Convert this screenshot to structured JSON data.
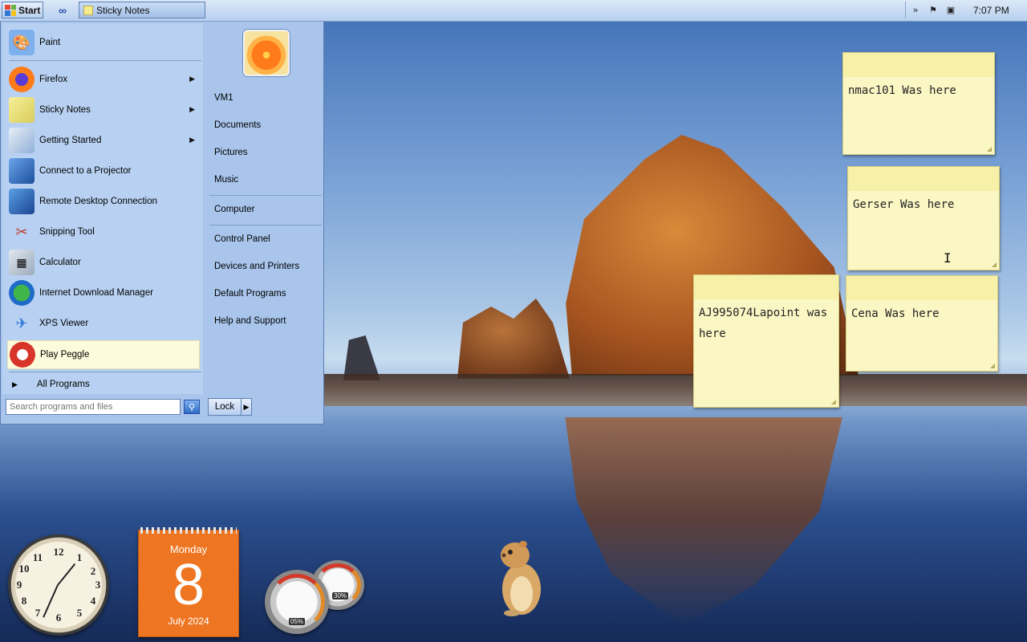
{
  "taskbar": {
    "start_label": "Start",
    "task_items": [
      {
        "label": "Sticky Notes"
      }
    ],
    "clock": "7:07 PM"
  },
  "start_menu": {
    "programs": [
      {
        "label": "Paint",
        "icon": "paint-icon",
        "has_submenu": false
      },
      {
        "label": "Firefox",
        "icon": "firefox-icon",
        "has_submenu": true
      },
      {
        "label": "Sticky Notes",
        "icon": "sticky-notes-icon",
        "has_submenu": true
      },
      {
        "label": "Getting Started",
        "icon": "getting-started-icon",
        "has_submenu": true
      },
      {
        "label": "Connect to a Projector",
        "icon": "projector-icon",
        "has_submenu": false
      },
      {
        "label": "Remote Desktop Connection",
        "icon": "remote-desktop-icon",
        "has_submenu": false
      },
      {
        "label": "Snipping Tool",
        "icon": "scissors-icon",
        "has_submenu": false
      },
      {
        "label": "Calculator",
        "icon": "calculator-icon",
        "has_submenu": false
      },
      {
        "label": "Internet Download Manager",
        "icon": "download-manager-icon",
        "has_submenu": false
      },
      {
        "label": "XPS Viewer",
        "icon": "xps-viewer-icon",
        "has_submenu": false
      },
      {
        "label": "Play Peggle",
        "icon": "peggle-icon",
        "has_submenu": false,
        "highlighted": true
      }
    ],
    "all_programs_label": "All Programs",
    "search_placeholder": "Search programs and files",
    "places": [
      {
        "label": "VM1"
      },
      {
        "label": "Documents"
      },
      {
        "label": "Pictures"
      },
      {
        "label": "Music"
      },
      {
        "label": "Computer"
      },
      {
        "label": "Control Panel"
      },
      {
        "label": "Devices and Printers"
      },
      {
        "label": "Default Programs"
      },
      {
        "label": "Help and Support"
      }
    ],
    "lock_label": "Lock"
  },
  "sticky_notes": [
    {
      "text": "nmac101 Was here"
    },
    {
      "text": "Gerser Was here"
    },
    {
      "text": "AJ995074Lapoint was here"
    },
    {
      "text": "Cena Was here"
    }
  ],
  "gadgets": {
    "calendar": {
      "day": "Monday",
      "date": "8",
      "month_year": "July 2024"
    },
    "clock_numbers": [
      "12",
      "1",
      "2",
      "3",
      "4",
      "5",
      "6",
      "7",
      "8",
      "9",
      "10",
      "11"
    ],
    "cpu_meter": {
      "cpu": "05%",
      "memory": "30%"
    }
  },
  "colors": {
    "accent": "#a9c5ec",
    "calendar": "#ee7622",
    "note": "#fbf7c4"
  }
}
